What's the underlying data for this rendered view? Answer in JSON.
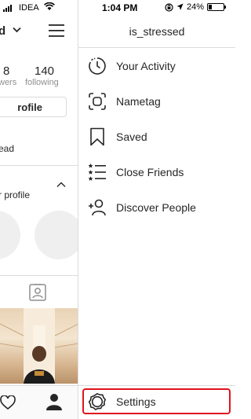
{
  "status_bar": {
    "carrier": "IDEA",
    "time": "1:04 PM",
    "battery_percent": "24%",
    "battery_level": 0.24
  },
  "profile": {
    "username_partial": "d",
    "followers_count_partial": "8",
    "followers_label_partial": "wers",
    "following_count": "140",
    "following_label": "following",
    "edit_profile_partial": "rofile",
    "bio_partial": "ead",
    "discover_text_partial": "r profile"
  },
  "drawer": {
    "title": "is_stressed",
    "items": [
      {
        "label": "Your Activity",
        "icon": "activity-icon"
      },
      {
        "label": "Nametag",
        "icon": "nametag-icon"
      },
      {
        "label": "Saved",
        "icon": "bookmark-icon"
      },
      {
        "label": "Close Friends",
        "icon": "close-friends-icon"
      },
      {
        "label": "Discover People",
        "icon": "add-person-icon"
      }
    ],
    "settings_label": "Settings"
  },
  "colors": {
    "highlight": "#e0141e",
    "divider": "#dbdbdb",
    "secondary_text": "#8e8e8e"
  }
}
